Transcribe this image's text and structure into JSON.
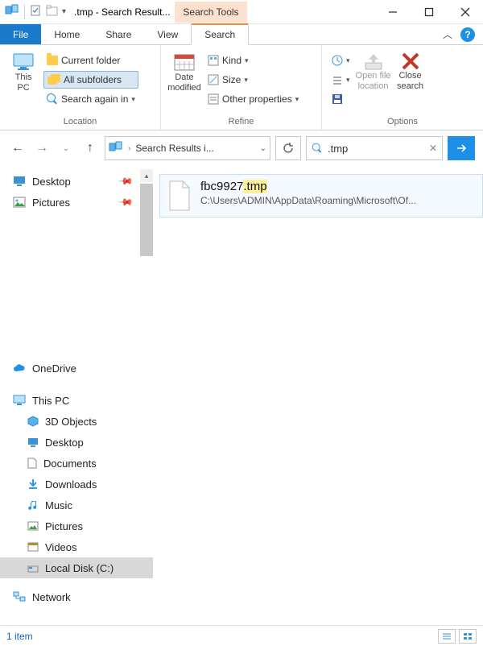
{
  "titlebar": {
    "title": ".tmp - Search Result...",
    "tools_tab": "Search Tools"
  },
  "ribbon_tabs": {
    "file": "File",
    "home": "Home",
    "share": "Share",
    "view": "View",
    "search": "Search"
  },
  "ribbon": {
    "location": {
      "group_label": "Location",
      "this_pc": "This\nPC",
      "current_folder": "Current folder",
      "all_subfolders": "All subfolders",
      "search_again_in": "Search again in"
    },
    "refine": {
      "group_label": "Refine",
      "date_modified": "Date\nmodified",
      "kind": "Kind",
      "size": "Size",
      "other_properties": "Other properties"
    },
    "options": {
      "group_label": "Options",
      "recent": "Recent searches",
      "advanced": "Advanced options",
      "save": "Save search",
      "open_location": "Open file\nlocation",
      "close_search": "Close\nsearch"
    }
  },
  "nav": {
    "address": "Search Results i...",
    "search_term": ".tmp"
  },
  "tree": {
    "quick": [
      {
        "label": "Desktop",
        "pinned": true
      },
      {
        "label": "Pictures",
        "pinned": true
      }
    ],
    "onedrive": "OneDrive",
    "thispc": "This PC",
    "thispc_children": [
      "3D Objects",
      "Desktop",
      "Documents",
      "Downloads",
      "Music",
      "Pictures",
      "Videos",
      "Local Disk (C:)"
    ],
    "network": "Network"
  },
  "results": [
    {
      "name_prefix": "fbc9927",
      "name_highlight": ".tmp",
      "path": "C:\\Users\\ADMIN\\AppData\\Roaming\\Microsoft\\Of..."
    }
  ],
  "status": {
    "count": "1 item"
  }
}
